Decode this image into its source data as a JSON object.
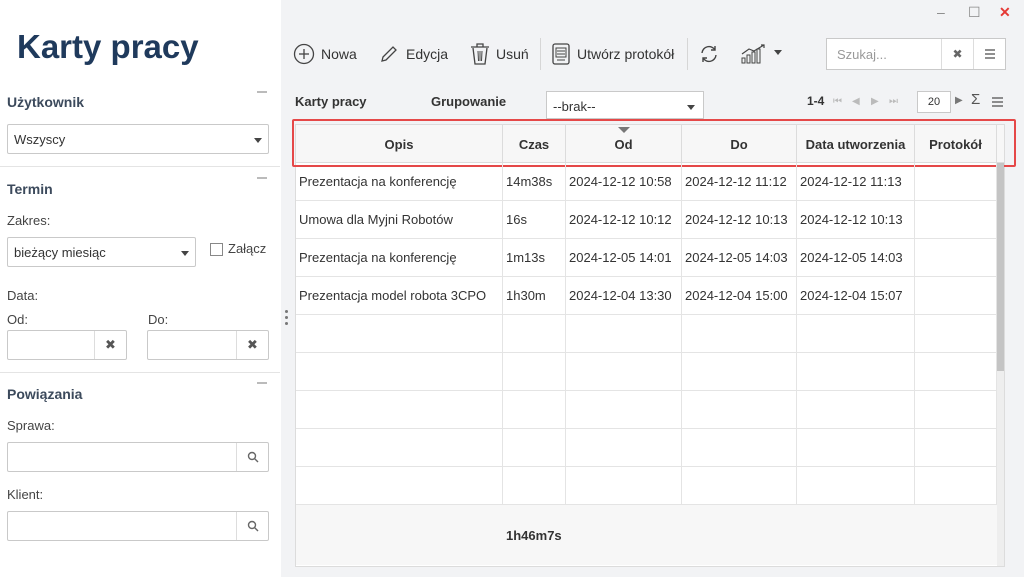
{
  "app": {
    "title": "Karty pracy"
  },
  "window": {
    "minimize": "–",
    "maximize": "☐",
    "close": "✕"
  },
  "filters": {
    "user": {
      "heading": "Użytkownik",
      "value": "Wszyscy"
    },
    "term": {
      "heading": "Termin",
      "range_label": "Zakres:",
      "range_value": "bieżący miesiąc",
      "attach_label": "Załącz",
      "date_label": "Data:",
      "from_label": "Od:",
      "to_label": "Do:"
    },
    "links": {
      "heading": "Powiązania",
      "case_label": "Sprawa:",
      "client_label": "Klient:"
    }
  },
  "toolbar": {
    "new": "Nowa",
    "edit": "Edycja",
    "delete": "Usuń",
    "create_protocol": "Utwórz protokół",
    "search_placeholder": "Szukaj..."
  },
  "grid": {
    "title": "Karty pracy",
    "grouping_label": "Grupowanie",
    "grouping_value": "--brak--",
    "pager_range": "1-4",
    "page_size": "20",
    "sum_symbol": "Σ",
    "columns": [
      "Opis",
      "Czas",
      "Od",
      "Do",
      "Data utworzenia",
      "Protokół"
    ],
    "rows": [
      [
        "Prezentacja na konferencję",
        "14m38s",
        "2024-12-12 10:58",
        "2024-12-12 11:12",
        "2024-12-12 11:13",
        ""
      ],
      [
        "Umowa dla Myjni Robotów",
        "16s",
        "2024-12-12 10:12",
        "2024-12-12 10:13",
        "2024-12-12 10:13",
        ""
      ],
      [
        "Prezentacja na konferencję",
        "1m13s",
        "2024-12-05 14:01",
        "2024-12-05 14:03",
        "2024-12-05 14:03",
        ""
      ],
      [
        "Prezentacja model robota 3CPO",
        "1h30m",
        "2024-12-04 13:30",
        "2024-12-04 15:00",
        "2024-12-04 15:07",
        ""
      ]
    ],
    "total_time": "1h46m7s"
  },
  "colors": {
    "title": "#1f3a5c",
    "highlight": "#e54848",
    "close": "#e53935"
  }
}
